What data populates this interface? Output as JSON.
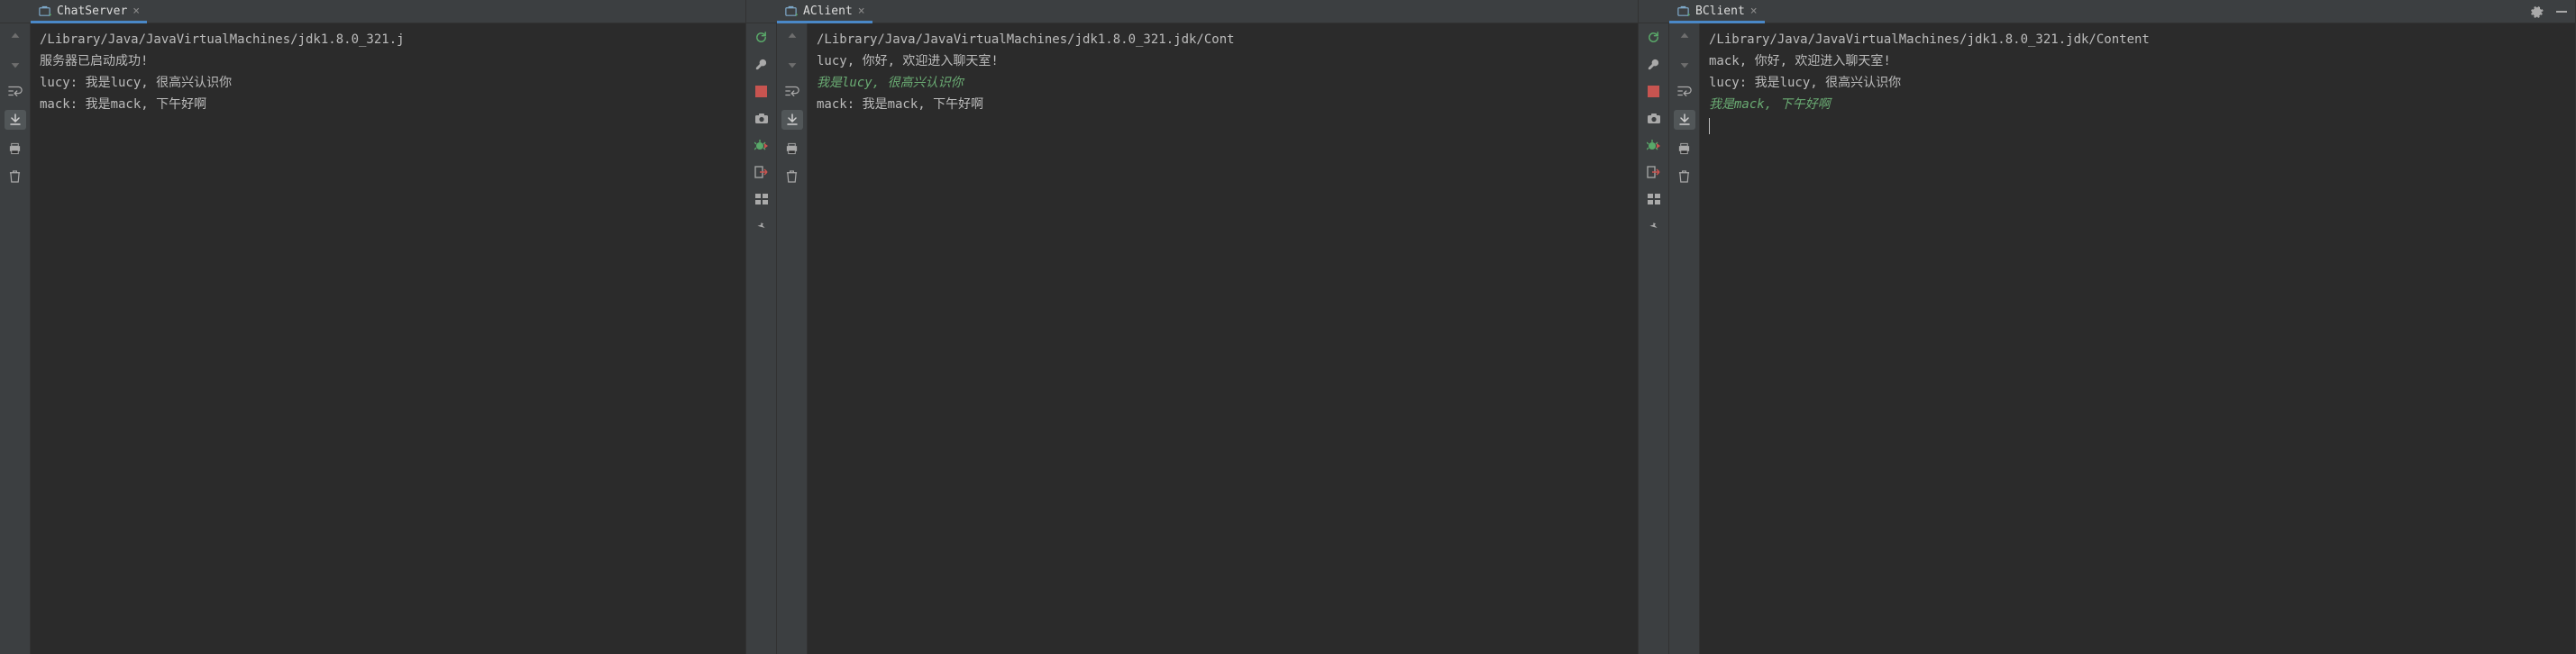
{
  "panes": [
    {
      "tab": {
        "label": "ChatServer"
      },
      "toolbar_type": "server",
      "lines": [
        {
          "kind": "std",
          "text": "/Library/Java/JavaVirtualMachines/jdk1.8.0_321.j"
        },
        {
          "kind": "std",
          "text": "服务器已启动成功!"
        },
        {
          "kind": "std",
          "text": "lucy: 我是lucy, 很高兴认识你"
        },
        {
          "kind": "std",
          "text": "mack: 我是mack, 下午好啊"
        }
      ],
      "has_caret": false
    },
    {
      "tab": {
        "label": "AClient"
      },
      "toolbar_type": "client",
      "lines": [
        {
          "kind": "std",
          "text": "/Library/Java/JavaVirtualMachines/jdk1.8.0_321.jdk/Cont"
        },
        {
          "kind": "std",
          "text": "lucy, 你好, 欢迎进入聊天室!"
        },
        {
          "kind": "input",
          "text": "我是lucy, 很高兴认识你"
        },
        {
          "kind": "std",
          "text": "mack: 我是mack, 下午好啊"
        }
      ],
      "has_caret": false
    },
    {
      "tab": {
        "label": "BClient"
      },
      "toolbar_type": "client",
      "right_actions": true,
      "lines": [
        {
          "kind": "std",
          "text": "/Library/Java/JavaVirtualMachines/jdk1.8.0_321.jdk/Content"
        },
        {
          "kind": "std",
          "text": "mack, 你好, 欢迎进入聊天室!"
        },
        {
          "kind": "std",
          "text": "lucy: 我是lucy, 很高兴认识你"
        },
        {
          "kind": "input",
          "text": "我是mack, 下午好啊"
        }
      ],
      "has_caret": true
    }
  ]
}
